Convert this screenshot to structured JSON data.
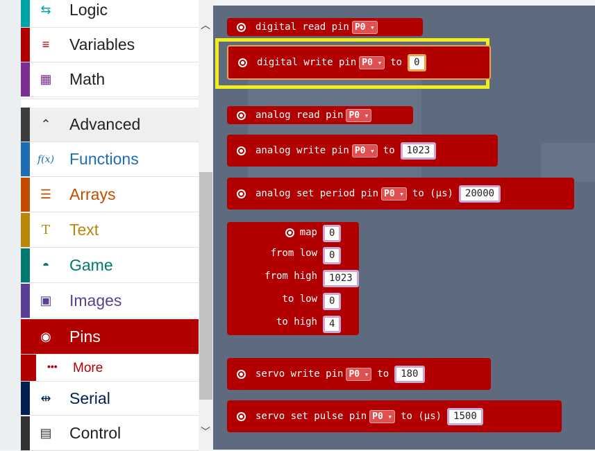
{
  "toolbox": {
    "categories": [
      {
        "label": "Logic",
        "color": "#00a4a6",
        "icon": "logic-icon"
      },
      {
        "label": "Variables",
        "color": "#b00000",
        "icon": "list-icon"
      },
      {
        "label": "Math",
        "color": "#7a2e8f",
        "icon": "calculator-icon"
      },
      {
        "label": "Advanced",
        "color": "#3c3c3c",
        "icon": "chevron-up-icon"
      },
      {
        "label": "Functions",
        "color": "#1c6db5",
        "icon": "function-icon"
      },
      {
        "label": "Arrays",
        "color": "#c24c00",
        "icon": "list-numbered-icon"
      },
      {
        "label": "Text",
        "color": "#b8860b",
        "icon": "text-icon"
      },
      {
        "label": "Game",
        "color": "#007a6e",
        "icon": "gamepad-icon"
      },
      {
        "label": "Images",
        "color": "#5b3e96",
        "icon": "image-icon"
      },
      {
        "label": "Pins",
        "color": "#b20000",
        "icon": "pin-icon"
      },
      {
        "label": "Serial",
        "color": "#002050",
        "icon": "usb-icon"
      },
      {
        "label": "Control",
        "color": "#333333",
        "icon": "control-icon"
      }
    ],
    "more_label": "More"
  },
  "blocks": {
    "digital_read": {
      "text": "digital read pin",
      "pin": "P0"
    },
    "digital_write": {
      "text": "digital write pin",
      "pin": "P0",
      "to": "to",
      "value": "0"
    },
    "analog_read": {
      "text": "analog read pin",
      "pin": "P0"
    },
    "analog_write": {
      "text": "analog write pin",
      "pin": "P0",
      "to": "to",
      "value": "1023"
    },
    "analog_set_period": {
      "text": "analog set period pin",
      "pin": "P0",
      "to": "to (μs)",
      "value": "20000"
    },
    "map": {
      "label": "map",
      "value": "0",
      "from_low": "from low",
      "from_low_value": "0",
      "from_high": "from high",
      "from_high_value": "1023",
      "to_low": "to low",
      "to_low_value": "0",
      "to_high": "to high",
      "to_high_value": "4"
    },
    "servo_write": {
      "text": "servo write pin",
      "pin": "P0",
      "to": "to",
      "value": "180"
    },
    "servo_pulse": {
      "text": "servo set pulse pin",
      "pin": "P0",
      "to": "to (μs)",
      "value": "1500"
    }
  },
  "colors": {
    "pins": "#b20000",
    "highlight": "#f2ee1e",
    "workspace": "#5e6b7f"
  }
}
